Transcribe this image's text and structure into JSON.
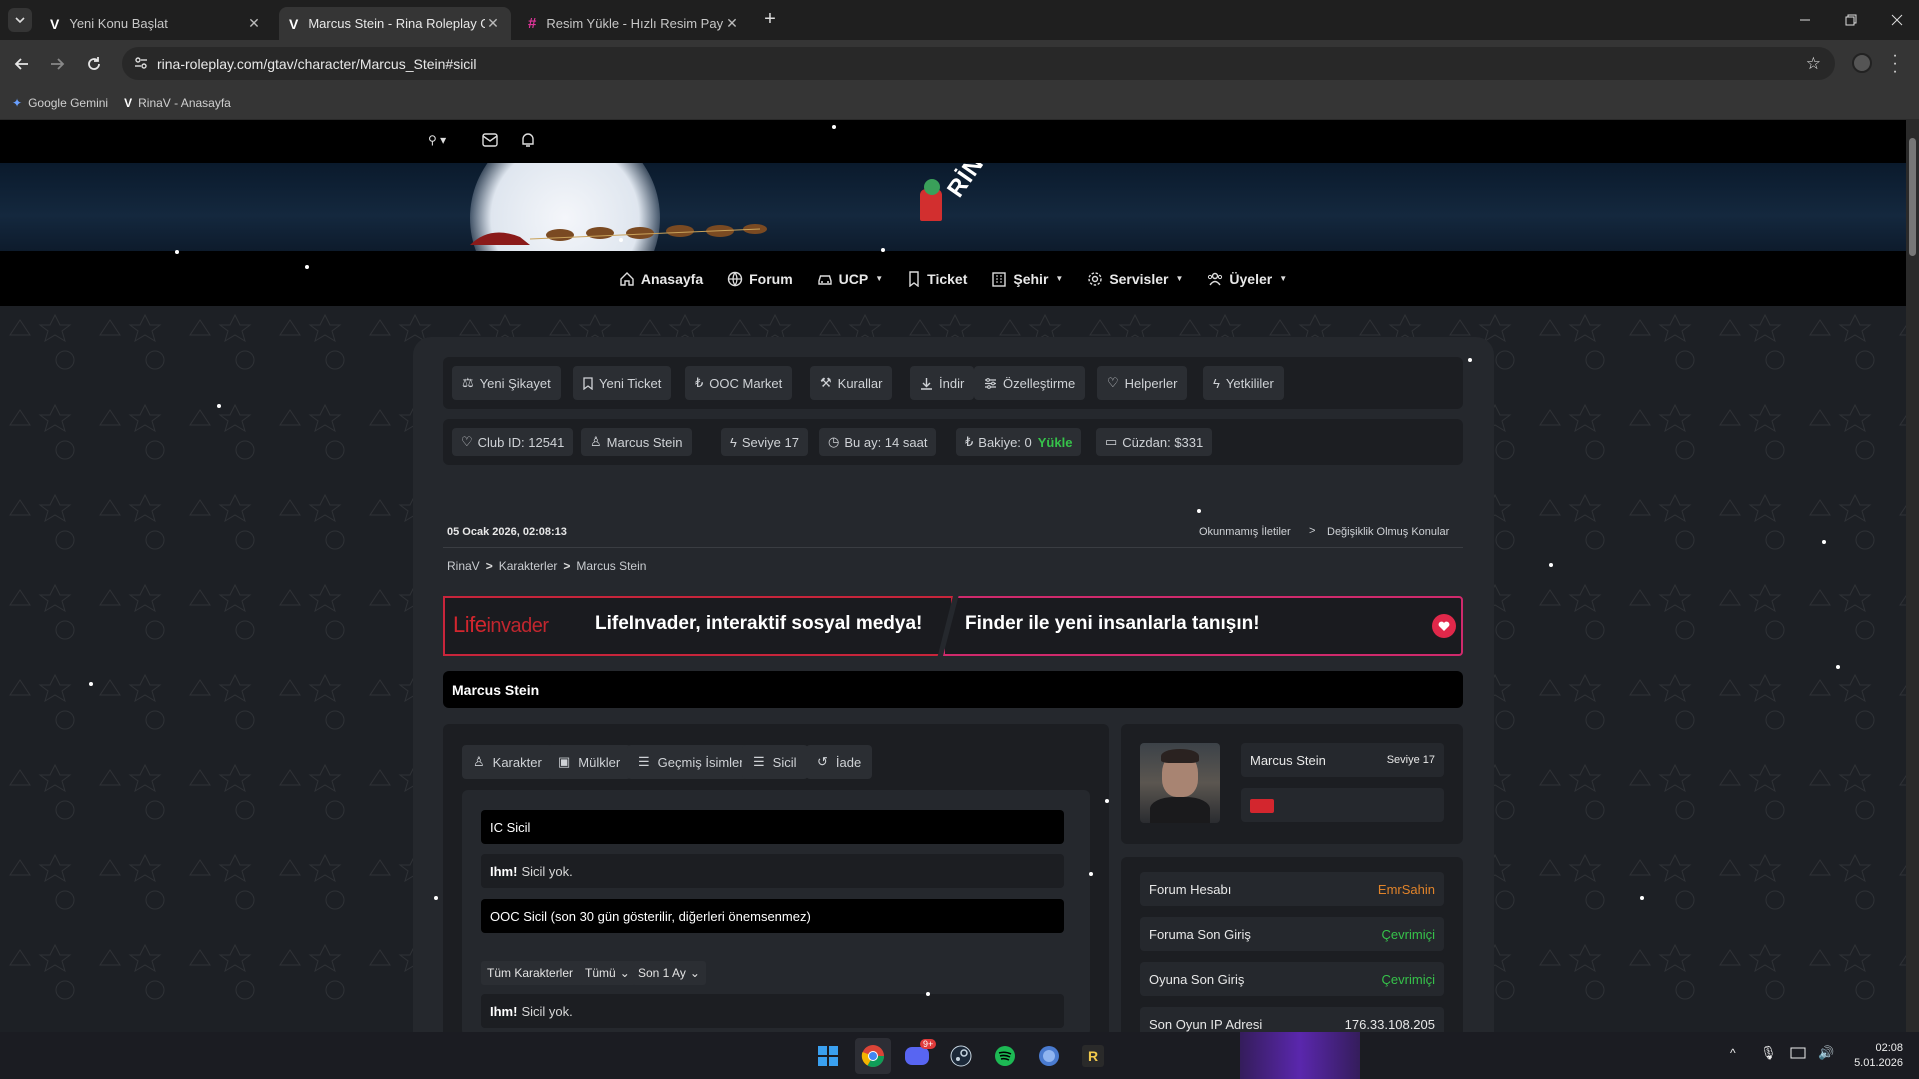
{
  "browser": {
    "tabs": [
      {
        "title": "Yeni Konu Başlat"
      },
      {
        "title": "Marcus Stein - Rina Roleplay GTA"
      },
      {
        "title": "Resim Yükle - Hızlı Resim Paylaş"
      }
    ],
    "url": "rina-roleplay.com/gtav/character/Marcus_Stein#sicil",
    "bookmarks": [
      "Google Gemini",
      "RinaV - Anasayfa"
    ]
  },
  "site": {
    "logo_text": "RİNA",
    "nav": [
      "Anasayfa",
      "Forum",
      "UCP",
      "Ticket",
      "Şehir",
      "Servisler",
      "Üyeler"
    ],
    "quick_actions": [
      "Yeni Şikayet",
      "Yeni Ticket",
      "OOC Market",
      "Kurallar",
      "İndir",
      "Özelleştirme",
      "Helperler",
      "Yetkililer"
    ],
    "info": {
      "club_id": "Club ID: 12541",
      "name": "Marcus Stein",
      "level": "Seviye 17",
      "month": "Bu ay: 14 saat",
      "balance": "Bakiye: 0",
      "load": "Yükle",
      "wallet": "Cüzdan: $331"
    },
    "datetime": "05 Ocak 2026, 02:08:13",
    "links": {
      "unread": "Okunmamış İletiler",
      "changed": "Değişiklik Olmuş Konular"
    },
    "breadcrumb": [
      "RinaV",
      "Karakterler",
      "Marcus Stein"
    ]
  },
  "ad": {
    "logo_life": "Life",
    "logo_invader": "invader",
    "left_text": "LifeInvader, interaktif sosyal medya!",
    "right_text": "Finder ile yeni insanlarla tanışın!"
  },
  "character": {
    "title": "Marcus Stein",
    "tabs": [
      "Karakter",
      "Mülkler",
      "Geçmiş İsimler",
      "Sicil",
      "İade"
    ],
    "ic_header": "IC Sicil",
    "ic_strong": "Ihm!",
    "ic_text": "Sicil yok.",
    "ooc_header": "OOC Sicil (son 30 gün gösterilir, diğerleri önemsenmez)",
    "filters": [
      "Tüm Karakterler",
      "Tümü",
      "Son 1 Ay"
    ],
    "ooc_strong": "Ihm!",
    "ooc_text": "Sicil yok.",
    "profile_name": "Marcus Stein",
    "profile_level": "Seviye 17"
  },
  "account": [
    {
      "key": "Forum Hesabı",
      "value": "EmrSahin",
      "color": "#e0832a"
    },
    {
      "key": "Foruma Son Giriş",
      "value": "Çevrimiçi",
      "color": "#36c24a"
    },
    {
      "key": "Oyuna Son Giriş",
      "value": "Çevrimiçi",
      "color": "#36c24a"
    },
    {
      "key": "Son Oyun IP Adresi",
      "value": "176.33.108.205",
      "color": "#e8e8e8"
    }
  ],
  "clock": {
    "time": "02:08",
    "date": "5.01.2026"
  },
  "taskbar_badge": "9+"
}
